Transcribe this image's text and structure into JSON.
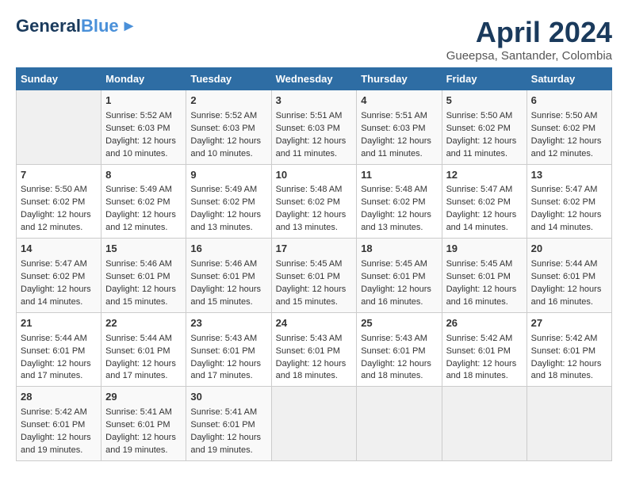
{
  "header": {
    "logo_general": "General",
    "logo_blue": "Blue",
    "month_title": "April 2024",
    "location": "Gueepsa, Santander, Colombia"
  },
  "weekdays": [
    "Sunday",
    "Monday",
    "Tuesday",
    "Wednesday",
    "Thursday",
    "Friday",
    "Saturday"
  ],
  "weeks": [
    [
      {
        "day": "",
        "sunrise": "",
        "sunset": "",
        "daylight": ""
      },
      {
        "day": "1",
        "sunrise": "Sunrise: 5:52 AM",
        "sunset": "Sunset: 6:03 PM",
        "daylight": "Daylight: 12 hours and 10 minutes."
      },
      {
        "day": "2",
        "sunrise": "Sunrise: 5:52 AM",
        "sunset": "Sunset: 6:03 PM",
        "daylight": "Daylight: 12 hours and 10 minutes."
      },
      {
        "day": "3",
        "sunrise": "Sunrise: 5:51 AM",
        "sunset": "Sunset: 6:03 PM",
        "daylight": "Daylight: 12 hours and 11 minutes."
      },
      {
        "day": "4",
        "sunrise": "Sunrise: 5:51 AM",
        "sunset": "Sunset: 6:03 PM",
        "daylight": "Daylight: 12 hours and 11 minutes."
      },
      {
        "day": "5",
        "sunrise": "Sunrise: 5:50 AM",
        "sunset": "Sunset: 6:02 PM",
        "daylight": "Daylight: 12 hours and 11 minutes."
      },
      {
        "day": "6",
        "sunrise": "Sunrise: 5:50 AM",
        "sunset": "Sunset: 6:02 PM",
        "daylight": "Daylight: 12 hours and 12 minutes."
      }
    ],
    [
      {
        "day": "7",
        "sunrise": "Sunrise: 5:50 AM",
        "sunset": "Sunset: 6:02 PM",
        "daylight": "Daylight: 12 hours and 12 minutes."
      },
      {
        "day": "8",
        "sunrise": "Sunrise: 5:49 AM",
        "sunset": "Sunset: 6:02 PM",
        "daylight": "Daylight: 12 hours and 12 minutes."
      },
      {
        "day": "9",
        "sunrise": "Sunrise: 5:49 AM",
        "sunset": "Sunset: 6:02 PM",
        "daylight": "Daylight: 12 hours and 13 minutes."
      },
      {
        "day": "10",
        "sunrise": "Sunrise: 5:48 AM",
        "sunset": "Sunset: 6:02 PM",
        "daylight": "Daylight: 12 hours and 13 minutes."
      },
      {
        "day": "11",
        "sunrise": "Sunrise: 5:48 AM",
        "sunset": "Sunset: 6:02 PM",
        "daylight": "Daylight: 12 hours and 13 minutes."
      },
      {
        "day": "12",
        "sunrise": "Sunrise: 5:47 AM",
        "sunset": "Sunset: 6:02 PM",
        "daylight": "Daylight: 12 hours and 14 minutes."
      },
      {
        "day": "13",
        "sunrise": "Sunrise: 5:47 AM",
        "sunset": "Sunset: 6:02 PM",
        "daylight": "Daylight: 12 hours and 14 minutes."
      }
    ],
    [
      {
        "day": "14",
        "sunrise": "Sunrise: 5:47 AM",
        "sunset": "Sunset: 6:02 PM",
        "daylight": "Daylight: 12 hours and 14 minutes."
      },
      {
        "day": "15",
        "sunrise": "Sunrise: 5:46 AM",
        "sunset": "Sunset: 6:01 PM",
        "daylight": "Daylight: 12 hours and 15 minutes."
      },
      {
        "day": "16",
        "sunrise": "Sunrise: 5:46 AM",
        "sunset": "Sunset: 6:01 PM",
        "daylight": "Daylight: 12 hours and 15 minutes."
      },
      {
        "day": "17",
        "sunrise": "Sunrise: 5:45 AM",
        "sunset": "Sunset: 6:01 PM",
        "daylight": "Daylight: 12 hours and 15 minutes."
      },
      {
        "day": "18",
        "sunrise": "Sunrise: 5:45 AM",
        "sunset": "Sunset: 6:01 PM",
        "daylight": "Daylight: 12 hours and 16 minutes."
      },
      {
        "day": "19",
        "sunrise": "Sunrise: 5:45 AM",
        "sunset": "Sunset: 6:01 PM",
        "daylight": "Daylight: 12 hours and 16 minutes."
      },
      {
        "day": "20",
        "sunrise": "Sunrise: 5:44 AM",
        "sunset": "Sunset: 6:01 PM",
        "daylight": "Daylight: 12 hours and 16 minutes."
      }
    ],
    [
      {
        "day": "21",
        "sunrise": "Sunrise: 5:44 AM",
        "sunset": "Sunset: 6:01 PM",
        "daylight": "Daylight: 12 hours and 17 minutes."
      },
      {
        "day": "22",
        "sunrise": "Sunrise: 5:44 AM",
        "sunset": "Sunset: 6:01 PM",
        "daylight": "Daylight: 12 hours and 17 minutes."
      },
      {
        "day": "23",
        "sunrise": "Sunrise: 5:43 AM",
        "sunset": "Sunset: 6:01 PM",
        "daylight": "Daylight: 12 hours and 17 minutes."
      },
      {
        "day": "24",
        "sunrise": "Sunrise: 5:43 AM",
        "sunset": "Sunset: 6:01 PM",
        "daylight": "Daylight: 12 hours and 18 minutes."
      },
      {
        "day": "25",
        "sunrise": "Sunrise: 5:43 AM",
        "sunset": "Sunset: 6:01 PM",
        "daylight": "Daylight: 12 hours and 18 minutes."
      },
      {
        "day": "26",
        "sunrise": "Sunrise: 5:42 AM",
        "sunset": "Sunset: 6:01 PM",
        "daylight": "Daylight: 12 hours and 18 minutes."
      },
      {
        "day": "27",
        "sunrise": "Sunrise: 5:42 AM",
        "sunset": "Sunset: 6:01 PM",
        "daylight": "Daylight: 12 hours and 18 minutes."
      }
    ],
    [
      {
        "day": "28",
        "sunrise": "Sunrise: 5:42 AM",
        "sunset": "Sunset: 6:01 PM",
        "daylight": "Daylight: 12 hours and 19 minutes."
      },
      {
        "day": "29",
        "sunrise": "Sunrise: 5:41 AM",
        "sunset": "Sunset: 6:01 PM",
        "daylight": "Daylight: 12 hours and 19 minutes."
      },
      {
        "day": "30",
        "sunrise": "Sunrise: 5:41 AM",
        "sunset": "Sunset: 6:01 PM",
        "daylight": "Daylight: 12 hours and 19 minutes."
      },
      {
        "day": "",
        "sunrise": "",
        "sunset": "",
        "daylight": ""
      },
      {
        "day": "",
        "sunrise": "",
        "sunset": "",
        "daylight": ""
      },
      {
        "day": "",
        "sunrise": "",
        "sunset": "",
        "daylight": ""
      },
      {
        "day": "",
        "sunrise": "",
        "sunset": "",
        "daylight": ""
      }
    ]
  ]
}
